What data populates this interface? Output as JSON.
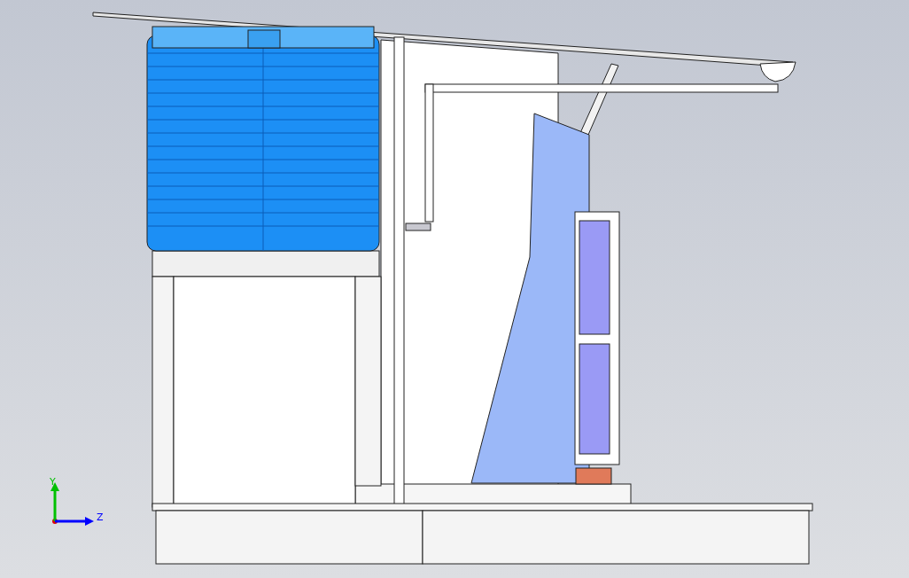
{
  "viewport": {
    "triad": [
      {
        "label": "Y",
        "color": "#00c000",
        "kind": "vertical"
      },
      {
        "label": "Z",
        "color": "#0000ff",
        "kind": "horizontal"
      }
    ]
  }
}
